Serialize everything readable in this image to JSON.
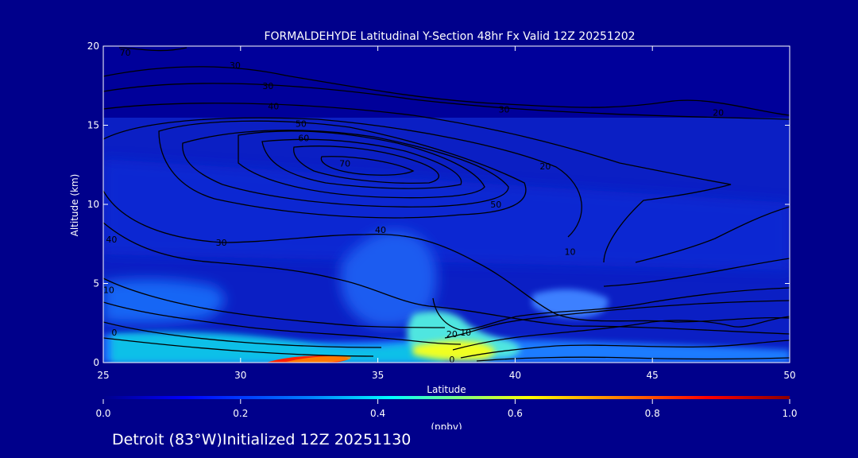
{
  "chart_data": {
    "type": "heatmap",
    "title": "FORMALDEHYDE Latitudinal Y-Section 48hr  Fx Valid 12Z 20251202",
    "xlabel": "Latitude",
    "ylabel": "Altitude (km)",
    "xlim": [
      25,
      50
    ],
    "ylim": [
      0,
      20
    ],
    "x_ticks": [
      "25",
      "30",
      "35",
      "40",
      "45",
      "50"
    ],
    "y_ticks": [
      "0",
      "5",
      "10",
      "15",
      "20"
    ],
    "colorbar": {
      "label": "(ppbv)",
      "range": [
        0.0,
        1.0
      ],
      "ticks": [
        "0.0",
        "0.2",
        "0.4",
        "0.6",
        "0.8",
        "1.0"
      ],
      "colors": [
        "#00008b",
        "#0000ff",
        "#0080ff",
        "#00ffff",
        "#80ff80",
        "#ffff00",
        "#ff8000",
        "#ff0000",
        "#8b0000"
      ]
    },
    "concentration_regions": [
      {
        "lat": 36.5,
        "alt": 0.6,
        "value": 0.6
      },
      {
        "lat": 38.0,
        "alt": 2.0,
        "value": 0.45
      },
      {
        "lat": 40.0,
        "alt": 0.8,
        "value": 0.45
      },
      {
        "lat": 33.5,
        "alt": 0.1,
        "value": 0.9
      },
      {
        "lat": 27.0,
        "alt": 0.6,
        "value": 0.35
      },
      {
        "lat": 37.0,
        "alt": 5.5,
        "value": 0.25
      },
      {
        "lat": 42.5,
        "alt": 3.7,
        "value": 0.25
      },
      {
        "lat": 27.5,
        "alt": 5.0,
        "value": 0.18
      },
      {
        "lat": 46.0,
        "alt": 1.0,
        "value": 0.15
      }
    ],
    "contour_labels": [
      {
        "text": "70",
        "lat": 25.8,
        "alt": 19.6
      },
      {
        "text": "30",
        "lat": 29.8,
        "alt": 18.8
      },
      {
        "text": "30",
        "lat": 31.0,
        "alt": 17.5
      },
      {
        "text": "40",
        "lat": 31.2,
        "alt": 16.2
      },
      {
        "text": "50",
        "lat": 32.2,
        "alt": 15.1
      },
      {
        "text": "60",
        "lat": 32.3,
        "alt": 14.2
      },
      {
        "text": "70",
        "lat": 33.8,
        "alt": 12.6
      },
      {
        "text": "50",
        "lat": 39.3,
        "alt": 10.0
      },
      {
        "text": "30",
        "lat": 39.6,
        "alt": 16.0
      },
      {
        "text": "20",
        "lat": 41.1,
        "alt": 12.4
      },
      {
        "text": "20",
        "lat": 47.4,
        "alt": 15.8
      },
      {
        "text": "40",
        "lat": 35.1,
        "alt": 8.4
      },
      {
        "text": "30",
        "lat": 29.3,
        "alt": 7.6
      },
      {
        "text": "40",
        "lat": 25.3,
        "alt": 7.8
      },
      {
        "text": "10",
        "lat": 25.2,
        "alt": 4.6
      },
      {
        "text": "10",
        "lat": 42.0,
        "alt": 7.0
      },
      {
        "text": "10",
        "lat": 38.2,
        "alt": 1.9
      },
      {
        "text": "20",
        "lat": 37.7,
        "alt": 1.8
      },
      {
        "text": "0",
        "lat": 25.4,
        "alt": 1.9
      },
      {
        "text": "0",
        "lat": 37.7,
        "alt": 0.2
      }
    ]
  },
  "footer": {
    "text": "Detroit (83°W)Initialized 12Z 20251130"
  }
}
